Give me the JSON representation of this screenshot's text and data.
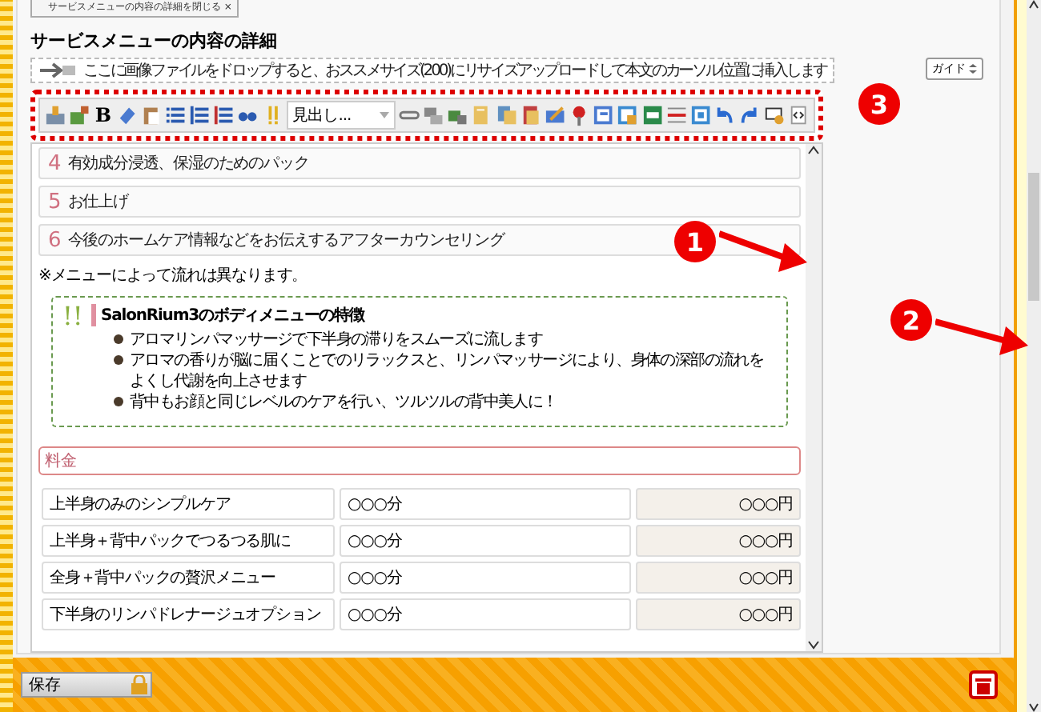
{
  "closed_tag": {
    "label": "サービスメニューの内容の詳細を閉じる ×"
  },
  "section_title": "サービスメニューの内容の詳細",
  "drop_hint": "ここに画像ファイルをドロップすると、おススメサイズ(200)にリサイズアップロードして本文のカーソル位置に挿入します",
  "guide_button": "ガイド",
  "toolbar": {
    "bold_label": "B",
    "heading_select": "見出し..."
  },
  "steps": [
    {
      "number": "4",
      "text": "有効成分浸透、保湿のためのパック"
    },
    {
      "number": "5",
      "text": "お仕上げ"
    },
    {
      "number": "6",
      "text": "今後のホームケア情報などをお伝えするアフターカウンセリング"
    }
  ],
  "note": "※メニューによって流れは異なります。",
  "feature_box": {
    "mark": "!!",
    "title": "SalonRium3のボディメニューの特徴",
    "bullets": [
      "アロマリンパマッサージで下半身の滞りをスムーズに流します",
      "アロマの香りが脳に届くことでのリラックスと、リンパマッサージにより、身体の深部の流れをよくし代謝を向上させます",
      "背中もお顔と同じレベルのケアを行い、ツルツルの背中美人に！"
    ]
  },
  "price_label": "料金",
  "price_rows": [
    {
      "name": "上半身のみのシンプルケア",
      "duration": "○○○分",
      "price": "○○○円"
    },
    {
      "name": "上半身＋背中パックでつるつる肌に",
      "duration": "○○○分",
      "price": "○○○円"
    },
    {
      "name": "全身＋背中パックの贅沢メニュー",
      "duration": "○○○分",
      "price": "○○○円"
    },
    {
      "name": "下半身のリンパドレナージュオプション",
      "duration": "○○○分",
      "price": "○○○円"
    }
  ],
  "save_button": "保存",
  "callouts": [
    {
      "number": "1"
    },
    {
      "number": "2"
    },
    {
      "number": "3"
    }
  ]
}
